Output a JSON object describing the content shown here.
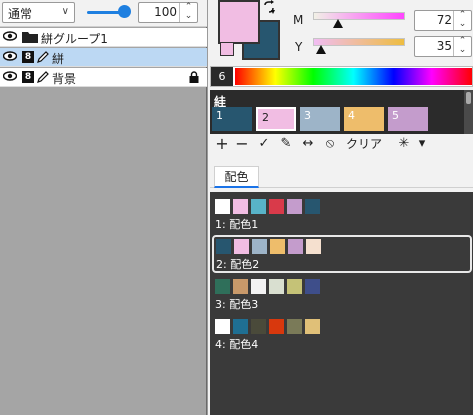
{
  "left": {
    "blend_mode": "通常",
    "opacity": "100",
    "layers": [
      {
        "name": "絣グループ1",
        "kind": "group"
      },
      {
        "name": "絣",
        "kind": "layer",
        "bit": "8",
        "selected": true
      },
      {
        "name": "背景",
        "kind": "layer",
        "bit": "8",
        "locked": true
      }
    ]
  },
  "color": {
    "main": "#f1bde3",
    "sub": "#27566f",
    "sliders": [
      {
        "label": "M",
        "value": "72"
      },
      {
        "label": "Y",
        "value": "35"
      }
    ],
    "hue_index": "6"
  },
  "palette_set": {
    "name": "絓",
    "tabs": [
      {
        "label": "1",
        "color": "#27566f"
      },
      {
        "label": "2",
        "color": "#f1bde3"
      },
      {
        "label": "3",
        "color": "#9db4c8"
      },
      {
        "label": "4",
        "color": "#eebd6b"
      },
      {
        "label": "5",
        "color": "#c49ccc"
      }
    ]
  },
  "toolbar": {
    "add": "+",
    "remove": "−",
    "check": "✓",
    "edit": "✎",
    "swap": "↔",
    "disable": "⦸",
    "clear": "クリア",
    "settings": "✳",
    "menu": "▾"
  },
  "tab": {
    "label": "配色"
  },
  "combos": [
    {
      "label": "1: 配色1",
      "colors": [
        "#ffffff",
        "#f1bde3",
        "#58b3c8",
        "#d93a4a",
        "#c49ccc",
        "#27566f"
      ]
    },
    {
      "label": "2: 配色2",
      "colors": [
        "#27566f",
        "#f1bde3",
        "#9db4c8",
        "#eebd6b",
        "#c49ccc",
        "#f5e0cf"
      ],
      "selected": true
    },
    {
      "label": "3: 配色3",
      "colors": [
        "#2f6f5a",
        "#c9996a",
        "#f2f2f2",
        "#d9dfd0",
        "#c5c277",
        "#3e4e8a"
      ]
    },
    {
      "label": "4: 配色4",
      "colors": [
        "#ffffff",
        "#1f6f93",
        "#4a4a3a",
        "#d8380d",
        "#7a7a58",
        "#e0c078"
      ]
    }
  ]
}
